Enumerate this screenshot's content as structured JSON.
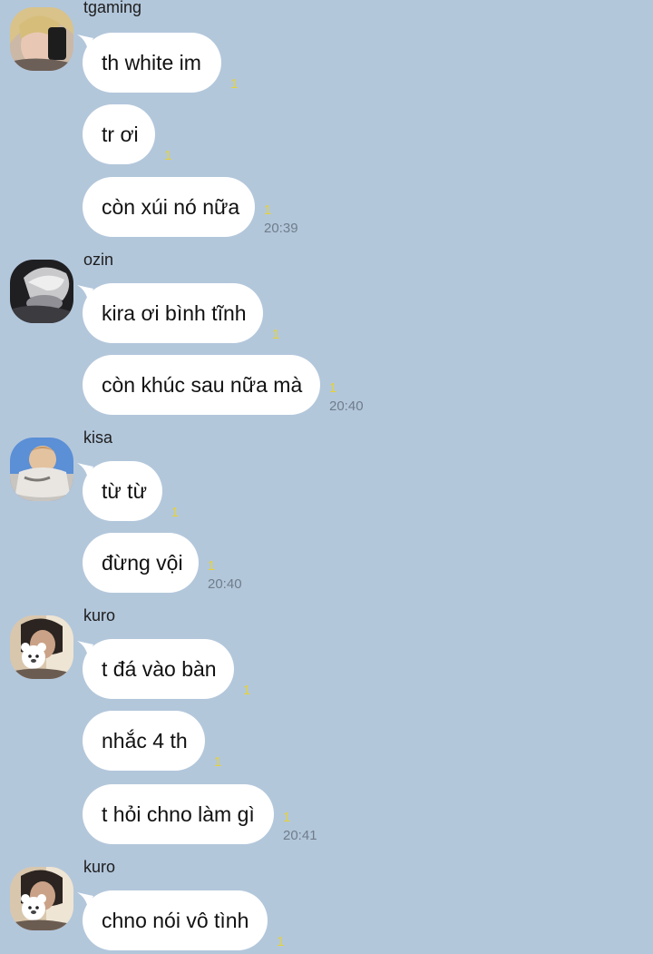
{
  "groups": [
    {
      "sender": "tgaming",
      "avatar_icon": "avatar-tgaming-icon",
      "messages": [
        {
          "text": "th white im",
          "unread": "1",
          "time": ""
        },
        {
          "text": "tr ơi",
          "unread": "1",
          "time": ""
        },
        {
          "text": "còn xúi nó nữa",
          "unread": "1",
          "time": "20:39"
        }
      ]
    },
    {
      "sender": "ozin",
      "avatar_icon": "avatar-ozin-icon",
      "messages": [
        {
          "text": "kira ơi bình tĩnh",
          "unread": "1",
          "time": ""
        },
        {
          "text": "còn khúc sau nữa mà",
          "unread": "1",
          "time": "20:40"
        }
      ]
    },
    {
      "sender": "kisa",
      "avatar_icon": "avatar-kisa-icon",
      "messages": [
        {
          "text": "từ từ",
          "unread": "1",
          "time": ""
        },
        {
          "text": "đừng vội",
          "unread": "1",
          "time": "20:40"
        }
      ]
    },
    {
      "sender": "kuro",
      "avatar_icon": "avatar-kuro-icon",
      "messages": [
        {
          "text": "t đá vào bàn",
          "unread": "1",
          "time": ""
        },
        {
          "text": "nhắc 4 th",
          "unread": "1",
          "time": ""
        },
        {
          "text": "t hỏi chno làm gì",
          "unread": "1",
          "time": "20:41"
        }
      ]
    },
    {
      "sender": "kuro",
      "avatar_icon": "avatar-kuro-icon",
      "messages": [
        {
          "text": "chno nói vô tình",
          "unread": "1",
          "time": ""
        }
      ]
    }
  ],
  "colors": {
    "background": "#b3c7db",
    "bubble": "#ffffff",
    "unread": "#e4d23a",
    "time": "#6f7d8b"
  }
}
